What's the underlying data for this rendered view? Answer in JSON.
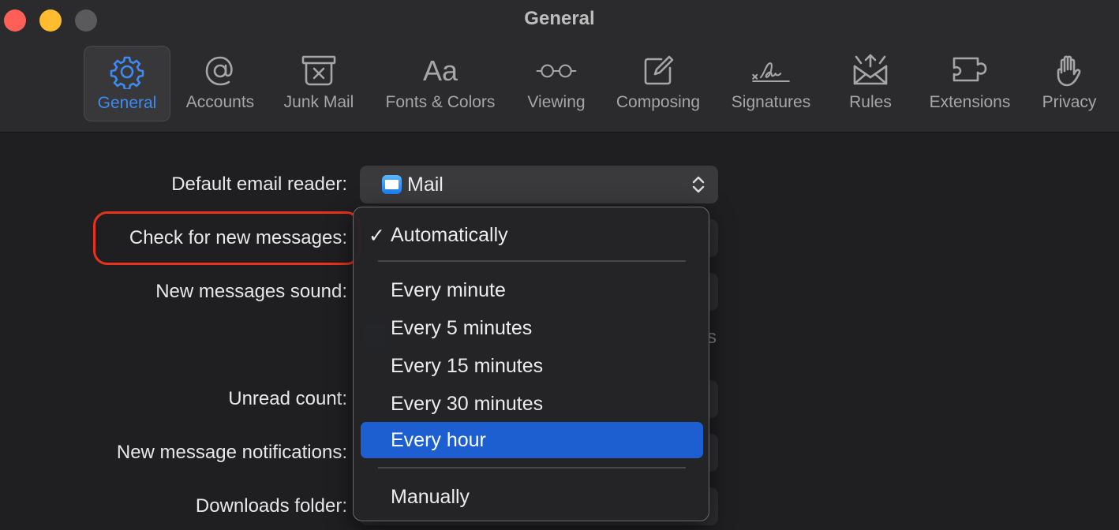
{
  "window": {
    "title": "General"
  },
  "toolbar": {
    "tabs": [
      {
        "label": "General",
        "icon": "gear-icon",
        "active": true
      },
      {
        "label": "Accounts",
        "icon": "at-sign-icon"
      },
      {
        "label": "Junk Mail",
        "icon": "junk-tray-icon"
      },
      {
        "label": "Fonts & Colors",
        "icon": "font-aa-icon",
        "glyph": "Aa"
      },
      {
        "label": "Viewing",
        "icon": "glasses-icon"
      },
      {
        "label": "Composing",
        "icon": "compose-icon"
      },
      {
        "label": "Signatures",
        "icon": "signature-icon"
      },
      {
        "label": "Rules",
        "icon": "rules-envelope-icon"
      },
      {
        "label": "Extensions",
        "icon": "puzzle-icon"
      },
      {
        "label": "Privacy",
        "icon": "hand-icon"
      }
    ]
  },
  "form": {
    "default_email_reader": {
      "label": "Default email reader:",
      "value": "Mail"
    },
    "check_new_messages": {
      "label": "Check for new messages:"
    },
    "new_messages_sound": {
      "label": "New messages sound:"
    },
    "unread_count": {
      "label": "Unread count:"
    },
    "new_message_notifications": {
      "label": "New message notifications:"
    },
    "downloads_folder": {
      "label": "Downloads folder:"
    },
    "partial_text": "s"
  },
  "dropdown": {
    "check_mark": "✓",
    "items": [
      {
        "label": "Automatically",
        "checked": true
      },
      {
        "label": "Every minute"
      },
      {
        "label": "Every 5 minutes"
      },
      {
        "label": "Every 15 minutes"
      },
      {
        "label": "Every 30 minutes"
      },
      {
        "label": "Every hour",
        "highlighted": true
      },
      {
        "label": "Manually"
      }
    ]
  },
  "colors": {
    "accent": "#3d8bf2",
    "selection": "#1d5fd0",
    "annotation": "#e8321c"
  }
}
